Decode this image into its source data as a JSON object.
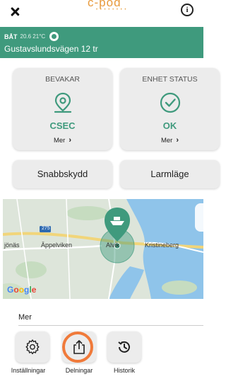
{
  "header": {
    "close_icon": "close-icon",
    "logo_text": "c-pod",
    "logo_dots": "• • • • • • • •",
    "info_icon": "i"
  },
  "banner": {
    "type": "BÅT",
    "meta": "20.6  21°C",
    "address": "Gustavslundsvägen 12 tr",
    "color": "#3f9a7d"
  },
  "cards": [
    {
      "title": "BEVAKAR",
      "icon": "location-pin-icon",
      "value": "CSEC",
      "more": "Mer"
    },
    {
      "title": "ENHET STATUS",
      "icon": "check-circle-icon",
      "value": "OK",
      "more": "Mer"
    }
  ],
  "buttons": {
    "quick_protect": "Snabbskydd",
    "alarm_mode": "Larmläge"
  },
  "map": {
    "labels": [
      "jönäs",
      "Äppelviken",
      "Alvik",
      "Kristineberg"
    ],
    "road_number": "275",
    "provider": [
      "G",
      "o",
      "o",
      "g",
      "l",
      "e"
    ]
  },
  "more": {
    "label": "Mer"
  },
  "actions": [
    {
      "label": "Inställningar",
      "icon": "gear-icon"
    },
    {
      "label": "Delningar",
      "icon": "share-icon"
    },
    {
      "label": "Historik",
      "icon": "history-icon"
    }
  ],
  "colors": {
    "accent": "#3f9a7d",
    "highlight_ring": "#f07a3a",
    "card_bg": "#ececec"
  }
}
